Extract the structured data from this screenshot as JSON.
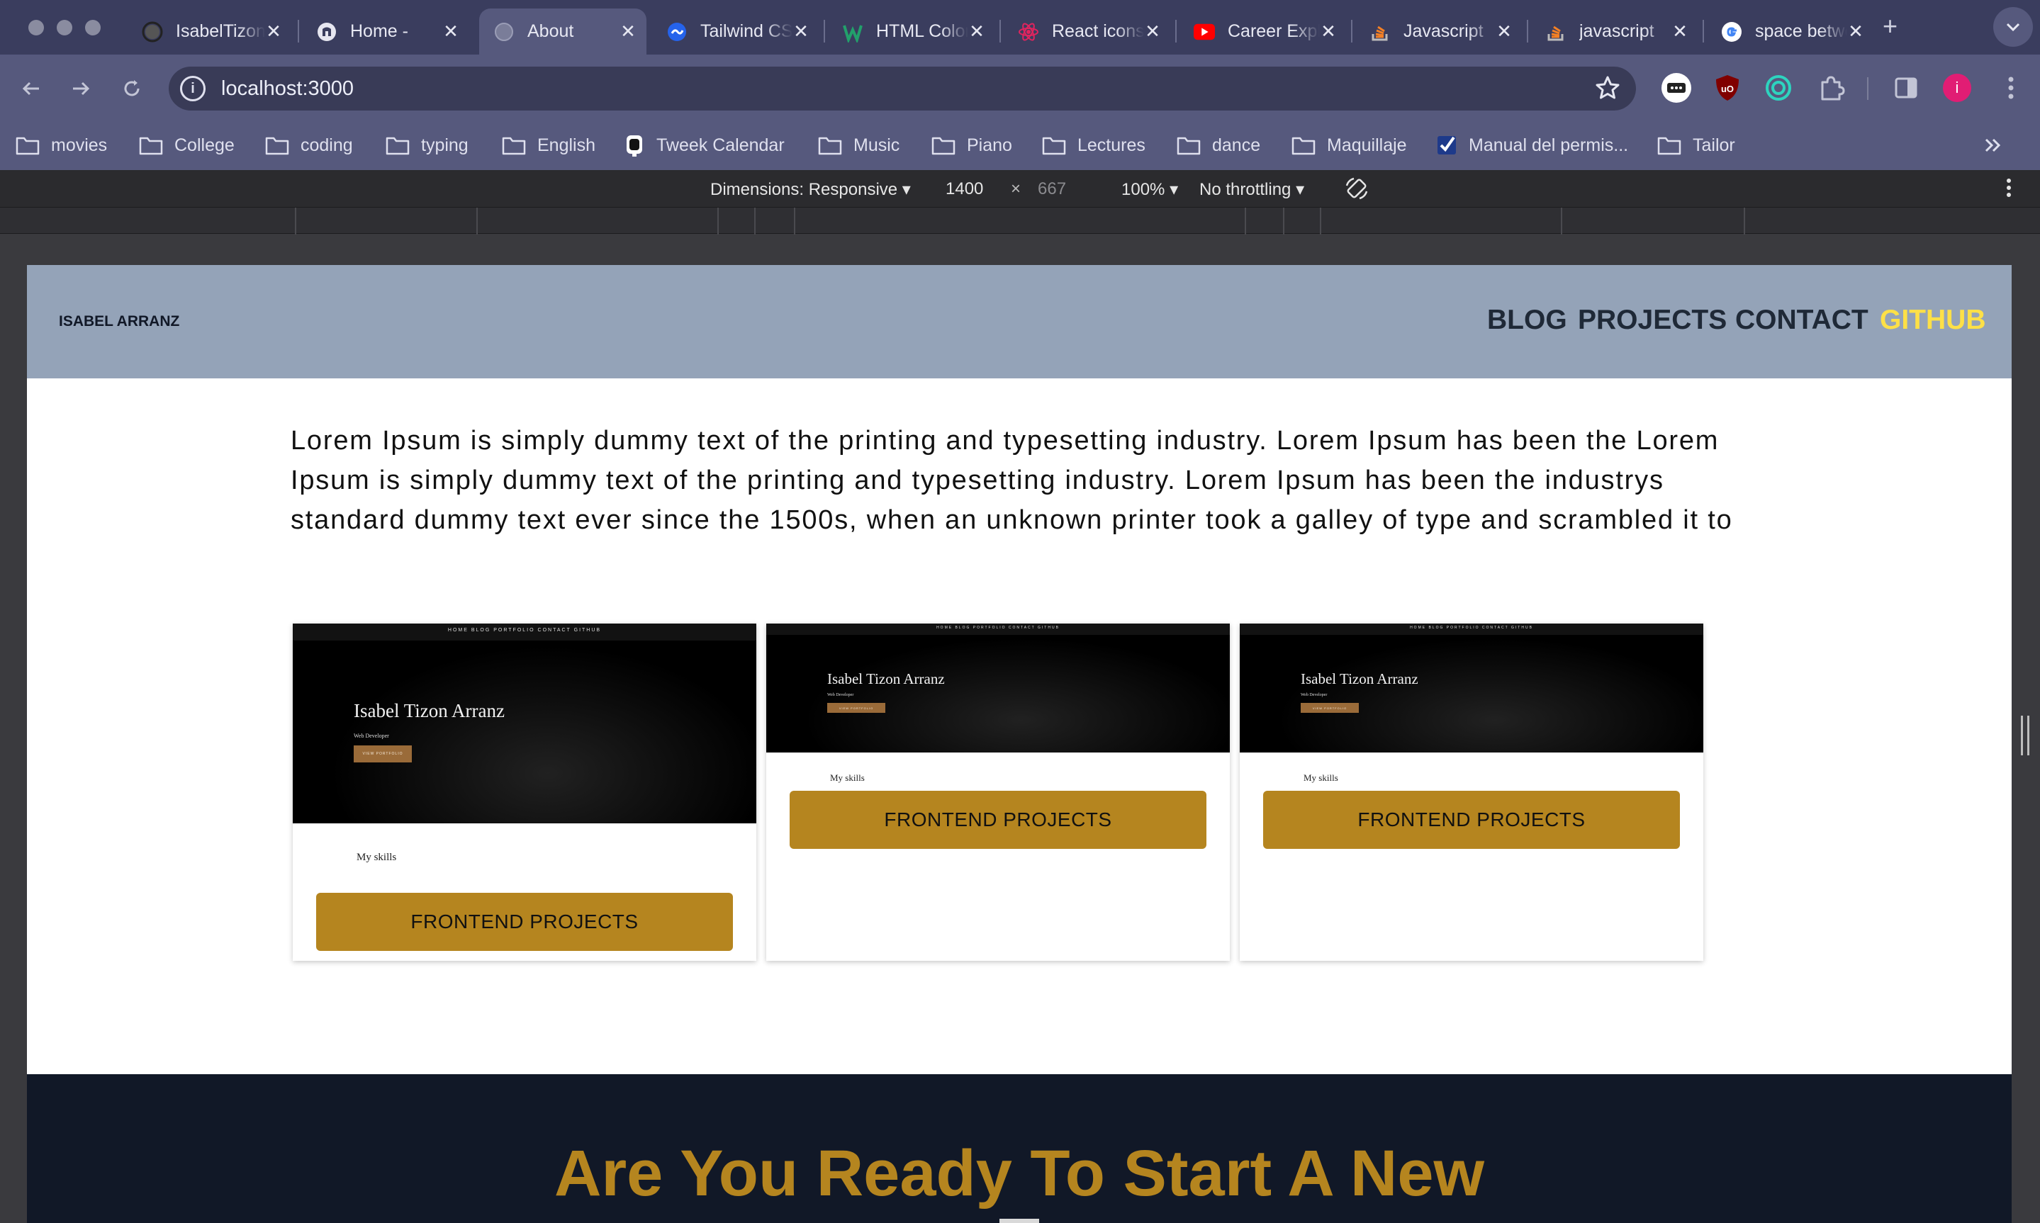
{
  "browser": {
    "tabs": [
      {
        "title": "IsabelTizon",
        "icon": "github-icon",
        "active": false
      },
      {
        "title": "Home - ",
        "icon": "gatsby-icon",
        "active": false
      },
      {
        "title": "About",
        "icon": "globe-icon",
        "active": true
      },
      {
        "title": "Tailwind CSS",
        "icon": "tailwind-icon",
        "active": false
      },
      {
        "title": "HTML Color",
        "icon": "w3-icon",
        "active": false
      },
      {
        "title": "React icons",
        "icon": "react-icon",
        "active": false
      },
      {
        "title": "Career Explorer",
        "icon": "youtube-icon",
        "active": false
      },
      {
        "title": "Javascript",
        "icon": "stackoverflow-icon",
        "active": false
      },
      {
        "title": "javascript",
        "icon": "stackoverflow-icon",
        "active": false
      },
      {
        "title": "space between",
        "icon": "google-icon",
        "active": false
      }
    ],
    "new_tab_label": "+",
    "url": "localhost:3000",
    "bookmarks": [
      {
        "label": "movies",
        "icon": "folder-icon"
      },
      {
        "label": "College",
        "icon": "folder-icon"
      },
      {
        "label": "coding",
        "icon": "folder-icon"
      },
      {
        "label": "typing",
        "icon": "folder-icon"
      },
      {
        "label": "English",
        "icon": "folder-icon"
      },
      {
        "label": "Tweek Calendar",
        "icon": "tweek-icon"
      },
      {
        "label": "Music",
        "icon": "folder-icon"
      },
      {
        "label": "Piano",
        "icon": "folder-icon"
      },
      {
        "label": "Lectures",
        "icon": "folder-icon"
      },
      {
        "label": "dance",
        "icon": "folder-icon"
      },
      {
        "label": "Maquillaje",
        "icon": "folder-icon"
      },
      {
        "label": "Manual del permis...",
        "icon": "checkmark-icon"
      },
      {
        "label": "Tailor",
        "icon": "folder-icon"
      }
    ],
    "profile_initial": "i",
    "accent": "#56597d"
  },
  "devtools": {
    "dimensions_label": "Dimensions: Responsive",
    "width": "1400",
    "times": "×",
    "height": "667",
    "zoom": "100%",
    "throttling": "No throttling"
  },
  "site": {
    "logo": "ISABEL ARRANZ",
    "nav": [
      {
        "label": "BLOG",
        "color": "#1f2937"
      },
      {
        "label": "PROJECTS",
        "color": "#1f2937"
      },
      {
        "label": "CONTACT",
        "color": "#1f2937"
      },
      {
        "label": "GITHUB",
        "color": "#fde047"
      }
    ],
    "intro": "Lorem Ipsum is simply dummy text of the printing and typesetting industry. Lorem Ipsum has been the Lorem Ipsum is simply dummy text of the printing and typesetting industry. Lorem Ipsum has been the industrys standard dummy text ever since the 1500s, when an unknown printer took a galley of type and scrambled it to",
    "cards": [
      {
        "preview_name": "Isabel Tizon Arranz",
        "preview_role": "Web Developer",
        "preview_button": "VIEW PORTFOLIO",
        "preview_nav": "HOME   BLOG   PORTFOLIO   CONTACT   GITHUB",
        "skills": "My skills",
        "button": "FRONTEND PROJECTS"
      },
      {
        "preview_name": "Isabel Tizon Arranz",
        "preview_role": "Web Developer",
        "preview_button": "VIEW PORTFOLIO",
        "preview_nav": "HOME   BLOG   PORTFOLIO   CONTACT   GITHUB",
        "skills": "My skills",
        "button": "FRONTEND PROJECTS"
      },
      {
        "preview_name": "Isabel Tizon Arranz",
        "preview_role": "Web Developer",
        "preview_button": "VIEW PORTFOLIO",
        "preview_nav": "HOME   BLOG   PORTFOLIO   CONTACT   GITHUB",
        "skills": "My skills",
        "button": "FRONTEND PROJECTS"
      }
    ],
    "footer_title": "Are You Ready To Start A New",
    "colors": {
      "header_bg": "#94a3b8",
      "gold": "#b5851f",
      "footer_bg": "#111827"
    }
  }
}
